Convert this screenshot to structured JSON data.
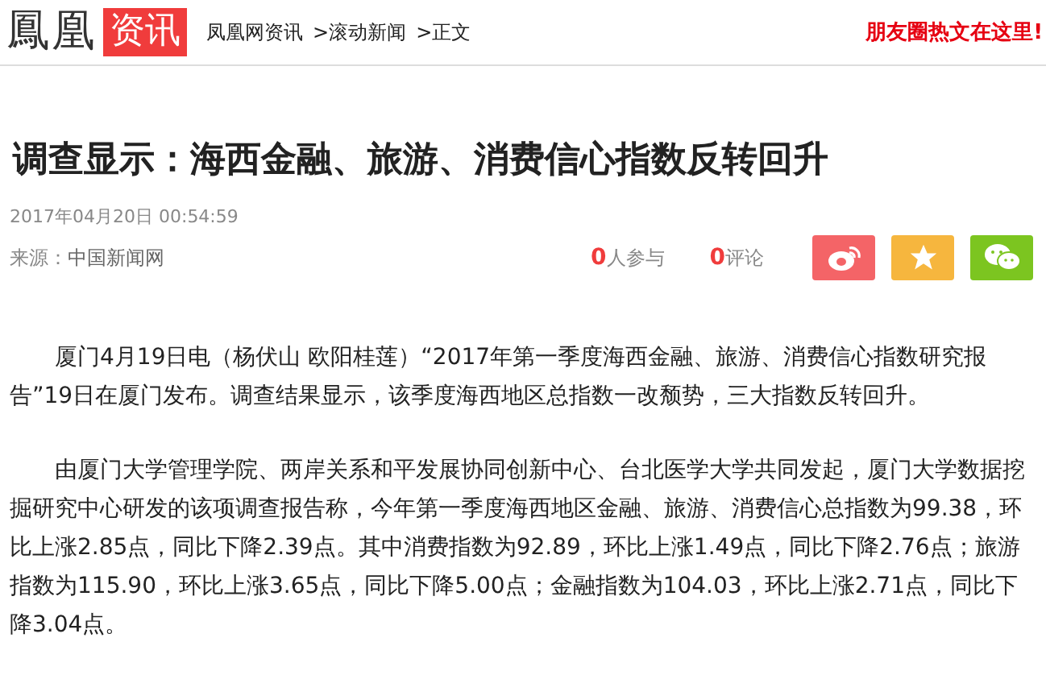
{
  "header": {
    "logo": "鳳凰",
    "logo_tag": "资讯",
    "breadcrumb": [
      "凤凰网资讯",
      ">滚动新闻",
      ">正文"
    ],
    "promo": "朋友圈热文在这里!"
  },
  "article": {
    "title": "调查显示：海西金融、旅游、消费信心指数反转回升",
    "date": "2017年04月20日  00:54:59",
    "source_label": "来源：",
    "source": "中国新闻网",
    "stats": [
      {
        "count": "0",
        "label": "人参与"
      },
      {
        "count": "0",
        "label": "评论"
      }
    ],
    "share": [
      {
        "kind": "weibo",
        "color": "#f46467"
      },
      {
        "kind": "qzone",
        "color": "#f6b63e"
      },
      {
        "kind": "wechat",
        "color": "#7cc520"
      }
    ],
    "paragraphs": [
      "厦门4月19日电（杨伏山 欧阳桂莲）“2017年第一季度海西金融、旅游、消费信心指数研究报告”19日在厦门发布。调查结果显示，该季度海西地区总指数一改颓势，三大指数反转回升。",
      "由厦门大学管理学院、两岸关系和平发展协同创新中心、台北医学大学共同发起，厦门大学数据挖掘研究中心研发的该项调查报告称，今年第一季度海西地区金融、旅游、消费信心总指数为99.38，环比上涨2.85点，同比下降2.39点。其中消费指数为92.89，环比上涨1.49点，同比下降2.76点；旅游指数为115.90，环比上涨3.65点，同比下降5.00点；金融指数为104.03，环比上涨2.71点，同比下降3.04点。"
    ]
  }
}
